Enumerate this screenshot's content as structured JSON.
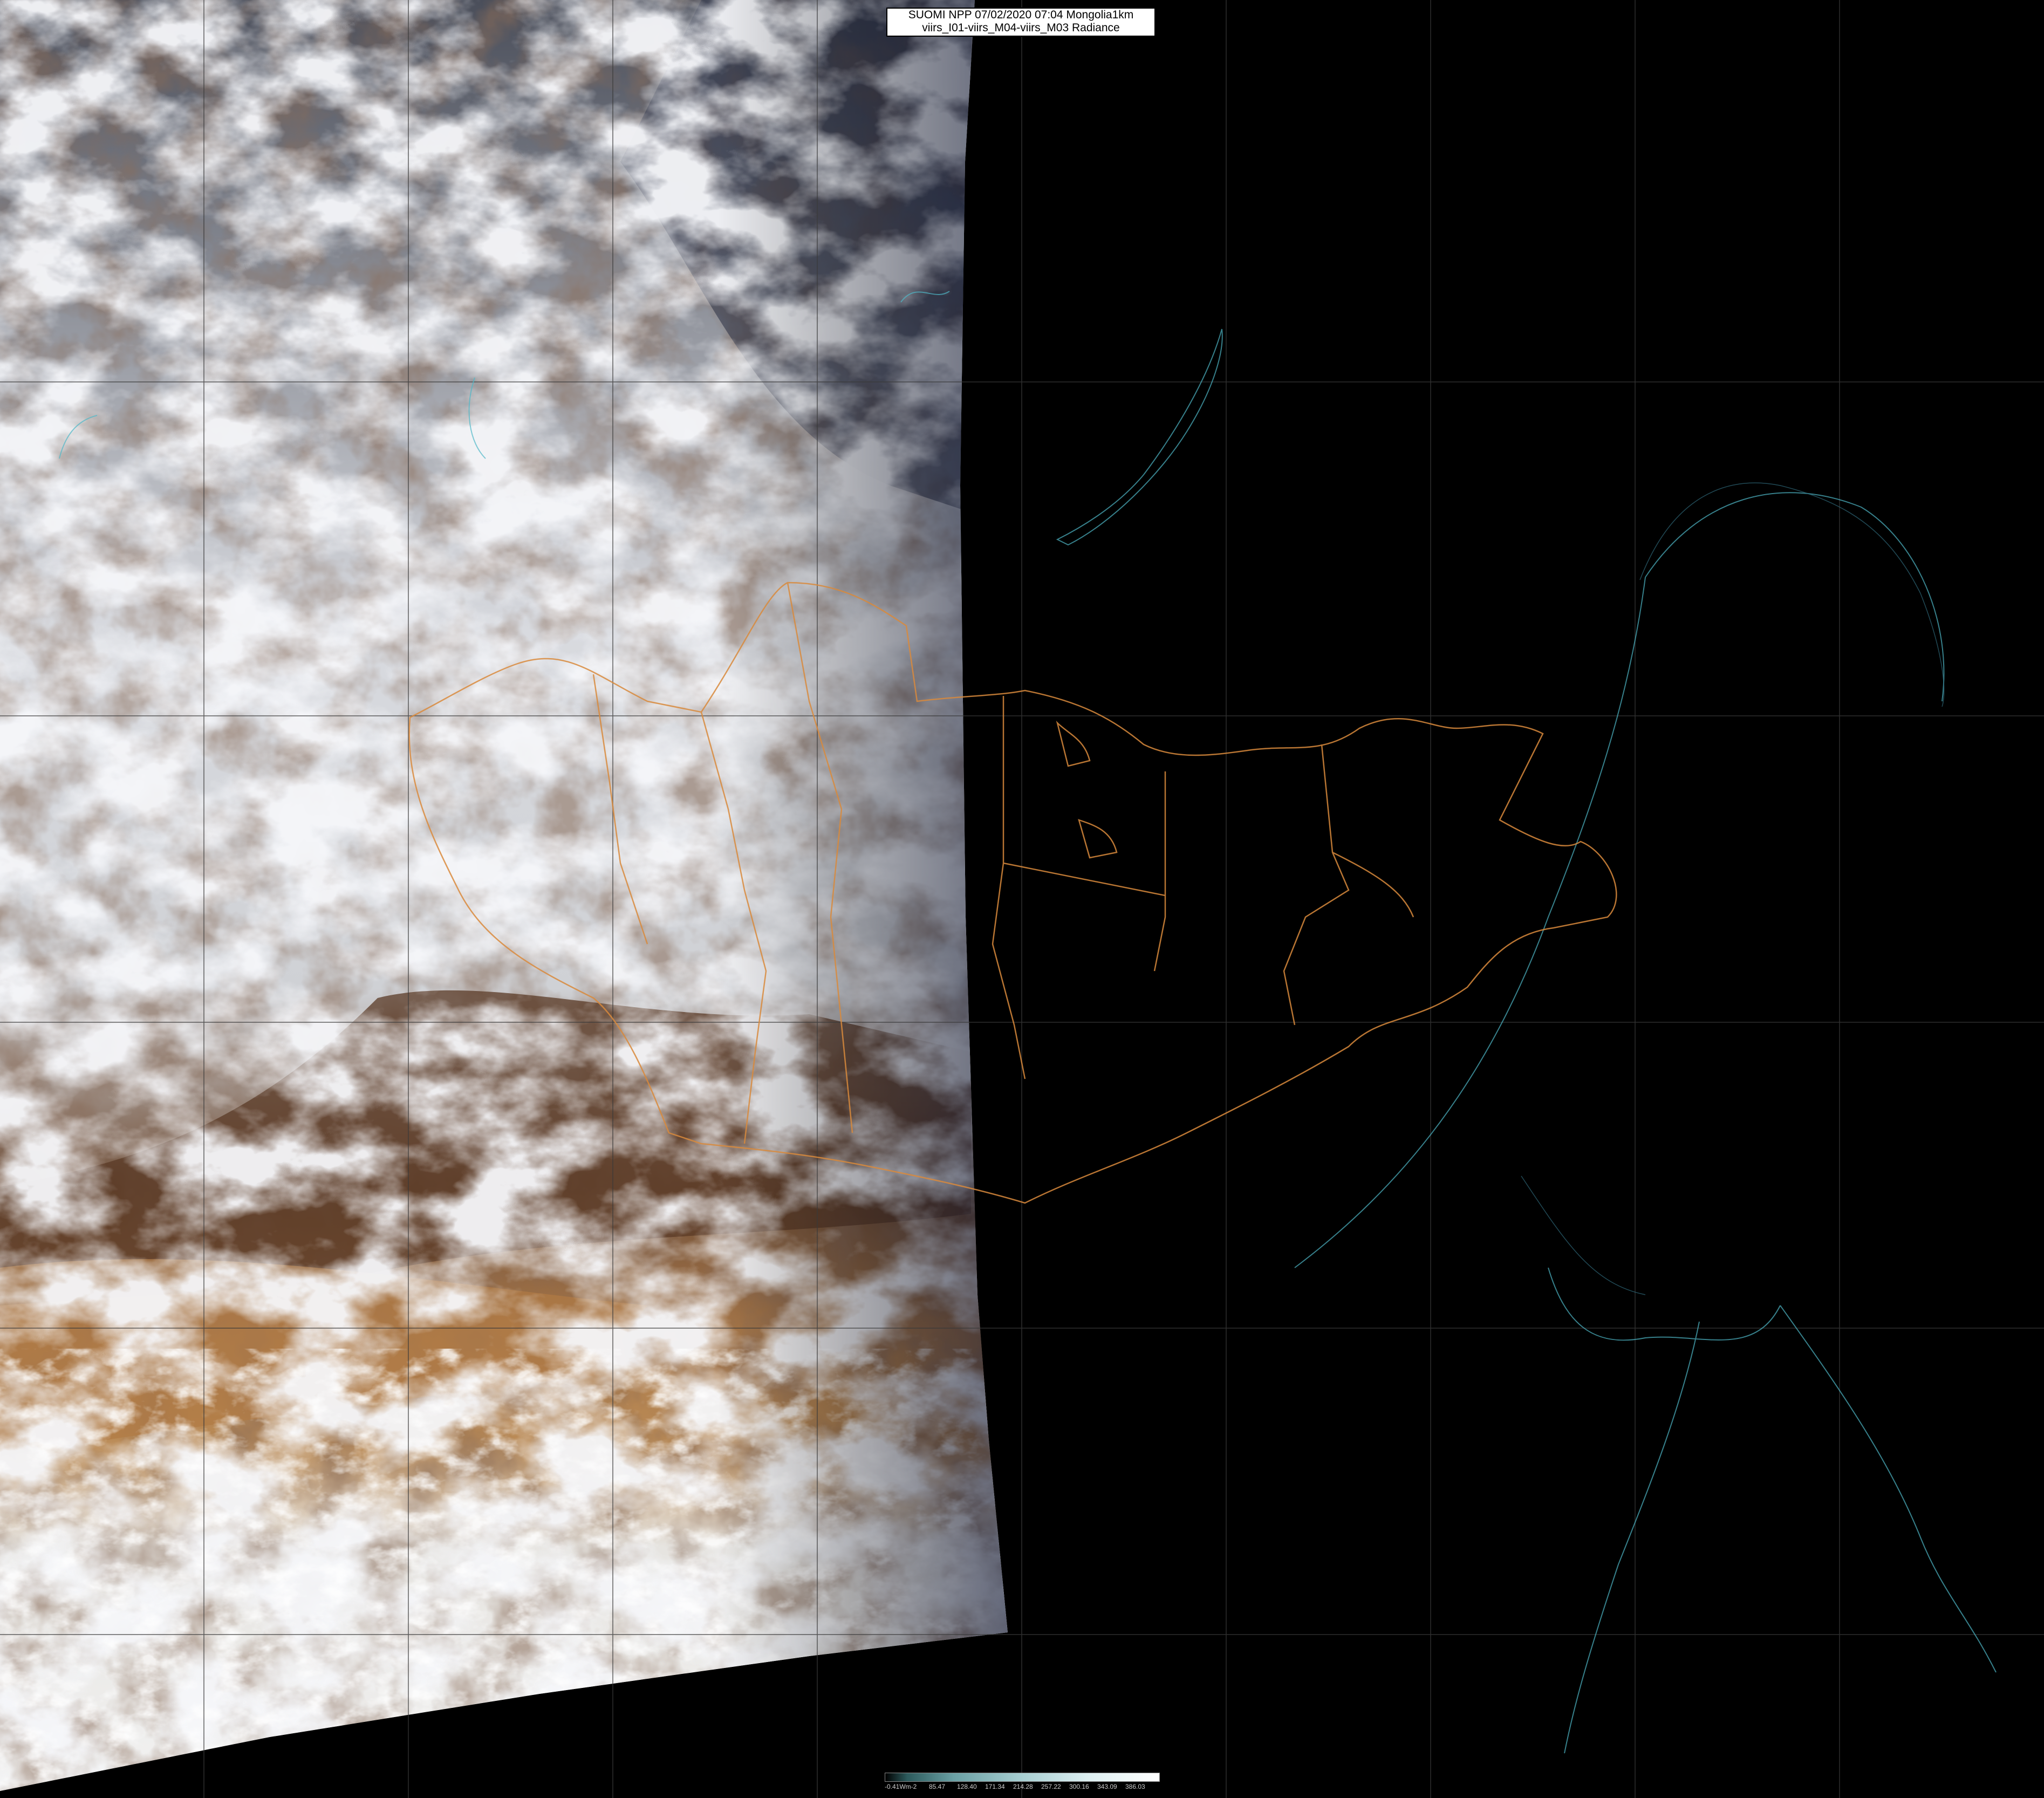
{
  "title": {
    "line1": "SUOMI NPP 07/02/2020 07:04 Mongolia1km",
    "line2": "viirs_I01-viirs_M04-viirs_M03 Radiance"
  },
  "colorbar": {
    "ticks": [
      "-0.41Wm-2",
      "85.47",
      "128.40",
      "171.34",
      "214.28",
      "257.22",
      "300.16",
      "343.09",
      "386.03"
    ]
  },
  "colors": {
    "background": "#000000",
    "admin_borders": "#d98a3c",
    "coastlines": "#4fb8c8",
    "grid": "#3a3a3a"
  }
}
